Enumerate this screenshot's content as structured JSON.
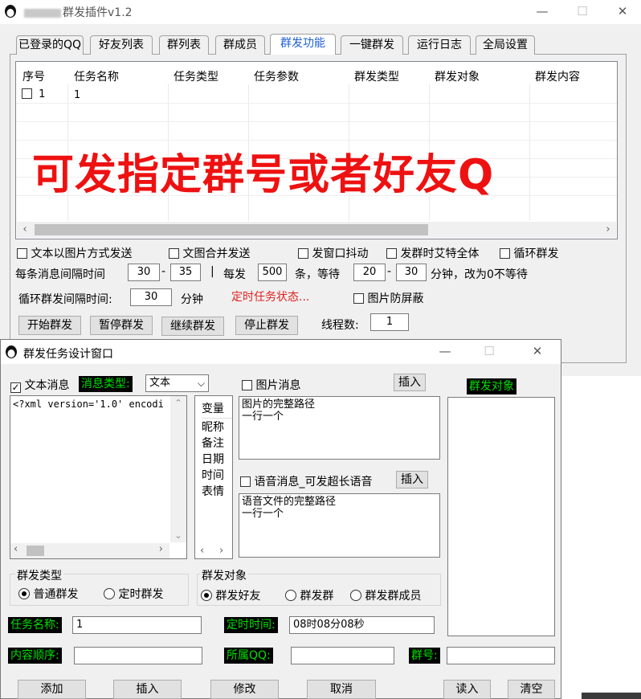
{
  "main_window": {
    "title": "群发插件v1.2",
    "tabs": [
      "已登录的QQ",
      "好友列表",
      "群列表",
      "群成员",
      "群发功能",
      "一键群发",
      "运行日志",
      "全局设置"
    ],
    "active_tab": "群发功能",
    "table": {
      "columns": [
        "序号",
        "任务名称",
        "任务类型",
        "任务参数",
        "群发类型",
        "群发对象",
        "群发内容"
      ],
      "rows": [
        {
          "index": "1",
          "name": "1"
        }
      ]
    },
    "overlay_text": "可发指定群号或者好友Q",
    "options": {
      "image_send": "文本以图片方式发送",
      "merge_send": "文图合并发送",
      "window_shake": "发窗口抖动",
      "at_all": "发群时艾特全体",
      "loop_send": "循环群发"
    },
    "interval": {
      "label": "每条消息间隔时间",
      "min": "30",
      "dash1": "-",
      "max": "35",
      "sep": "|",
      "each_label": "每发",
      "each_count": "500",
      "wait_label": "条，等待",
      "wait_min": "20",
      "dash2": "-",
      "wait_max": "30",
      "wait_suffix": "分钟，改为0不等待"
    },
    "loop_interval": {
      "label": "循环群发间隔时间:",
      "value": "30",
      "unit": "分钟"
    },
    "timer_status": "定时任务状态...",
    "anti_block": "图片防屏蔽",
    "buttons": {
      "start": "开始群发",
      "pause": "暂停群发",
      "resume": "继续群发",
      "stop": "停止群发"
    },
    "threads": {
      "label": "线程数:",
      "value": "1"
    }
  },
  "dialog": {
    "title": "群发任务设计窗口",
    "text_msg_label": "文本消息",
    "msg_type_label": "消息类型:",
    "msg_type_value": "文本",
    "text_content": "<?xml version='1.0' encodi",
    "variables_header": "变量",
    "variables": [
      "昵称",
      "备注",
      "日期",
      "时间",
      "表情"
    ],
    "image_msg_label": "图片消息",
    "insert_label": "插入",
    "image_hint": "图片的完整路径\n一行一个",
    "voice_label": "语音消息_可发超长语音",
    "voice_hint": "语音文件的完整路径\n一行一个",
    "target_header": "群发对象",
    "send_type": {
      "legend": "群发类型",
      "normal": "普通群发",
      "timed": "定时群发"
    },
    "send_target": {
      "legend": "群发对象",
      "friends": "群发好友",
      "groups": "群发群",
      "members": "群发群成员"
    },
    "task_name_label": "任务名称:",
    "task_name_value": "1",
    "timed_time_label": "定时时间:",
    "timed_time_value": "08时08分08秒",
    "content_order_label": "内容顺序:",
    "owner_qq_label": "所属QQ:",
    "group_no_label": "群号:",
    "buttons": {
      "add": "添加",
      "insert": "插入",
      "modify": "修改",
      "cancel": "取消",
      "read": "读入",
      "clear": "清空"
    }
  },
  "colors": {
    "accent_tab": "#1f5fd6",
    "overlay_red": "#ee1111",
    "green_label": "#00e000",
    "status_red": "#e02222"
  },
  "icons": [
    "app-icon",
    "minimize-icon",
    "maximize-icon",
    "close-icon",
    "checkbox-icon",
    "radio-icon",
    "scroll-arrow-icon",
    "dropdown-icon"
  ]
}
